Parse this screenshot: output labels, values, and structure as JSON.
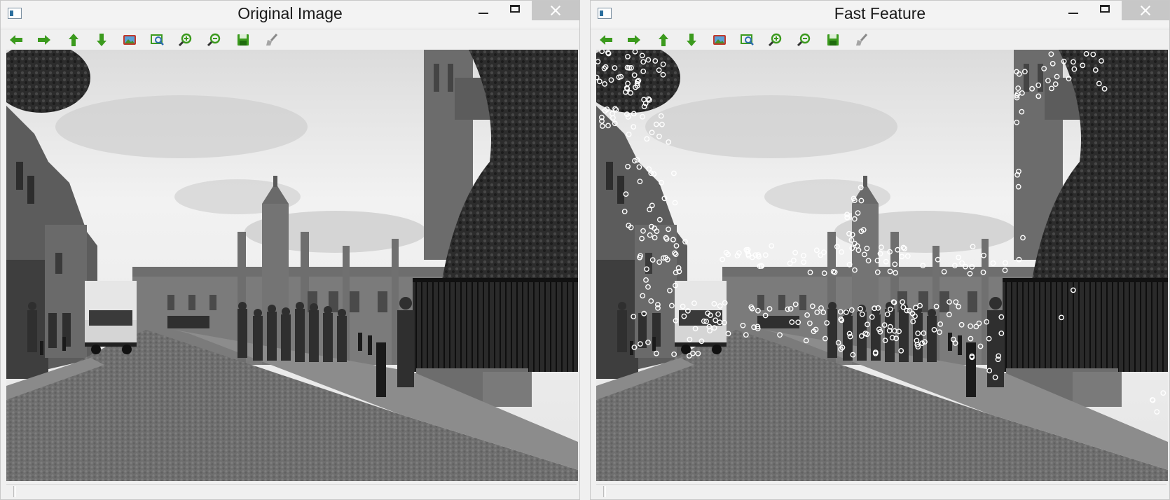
{
  "windows": [
    {
      "title": "Original Image"
    },
    {
      "title": "Fast Feature"
    }
  ],
  "toolbar": {
    "buttons": [
      "arrow-left-icon",
      "arrow-right-icon",
      "arrow-up-icon",
      "arrow-down-icon",
      "image-icon",
      "zoom-fit-icon",
      "zoom-in-icon",
      "zoom-out-icon",
      "save-icon",
      "brush-icon"
    ]
  },
  "colors": {
    "toolbar_icon_green": "#3b9a1d",
    "keypoint_marker": "#ffffff"
  }
}
